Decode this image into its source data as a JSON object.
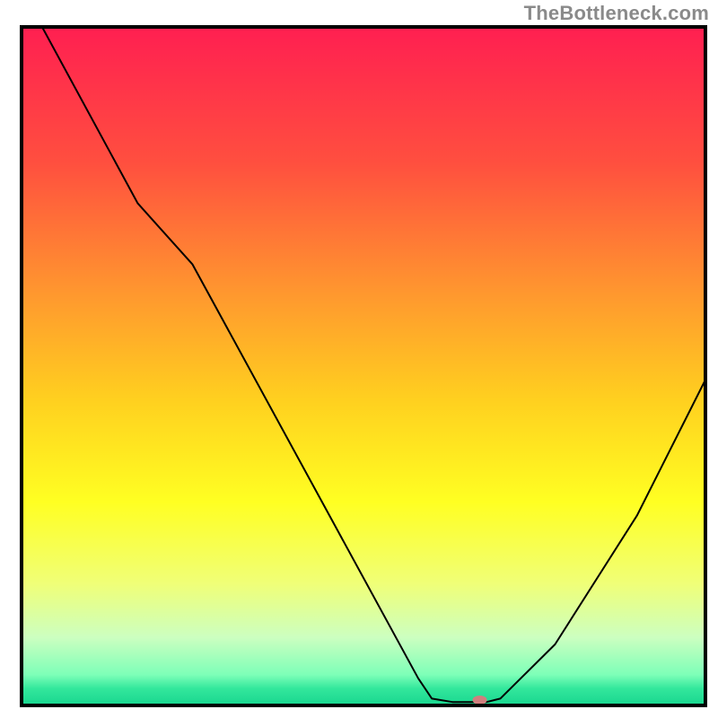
{
  "watermark": "TheBottleneck.com",
  "chart_data": {
    "type": "line",
    "title": "",
    "xlabel": "",
    "ylabel": "",
    "xlim": [
      0,
      100
    ],
    "ylim": [
      0,
      100
    ],
    "grid": false,
    "legend": false,
    "background_gradient": {
      "type": "vertical",
      "stops": [
        {
          "offset": 0.0,
          "color": "#ff1f51"
        },
        {
          "offset": 0.2,
          "color": "#ff4f3f"
        },
        {
          "offset": 0.4,
          "color": "#ff9a2e"
        },
        {
          "offset": 0.55,
          "color": "#ffd01f"
        },
        {
          "offset": 0.7,
          "color": "#ffff22"
        },
        {
          "offset": 0.82,
          "color": "#f0ff77"
        },
        {
          "offset": 0.9,
          "color": "#ccffc0"
        },
        {
          "offset": 0.955,
          "color": "#7dffb8"
        },
        {
          "offset": 0.975,
          "color": "#33e79c"
        },
        {
          "offset": 1.0,
          "color": "#18d68f"
        }
      ]
    },
    "curve_color": "#000000",
    "curve_width": 2,
    "curve": [
      {
        "x": 3,
        "y": 100
      },
      {
        "x": 17,
        "y": 74
      },
      {
        "x": 25,
        "y": 65
      },
      {
        "x": 58,
        "y": 4
      },
      {
        "x": 60,
        "y": 1
      },
      {
        "x": 63,
        "y": 0.5
      },
      {
        "x": 68,
        "y": 0.5
      },
      {
        "x": 70,
        "y": 1
      },
      {
        "x": 78,
        "y": 9
      },
      {
        "x": 90,
        "y": 28
      },
      {
        "x": 100,
        "y": 48
      }
    ],
    "marker": {
      "x": 67,
      "y": 0.8,
      "color": "#d07f7e",
      "rx": 8,
      "ry": 5
    },
    "frame": {
      "color": "#000000",
      "width": 4
    }
  }
}
